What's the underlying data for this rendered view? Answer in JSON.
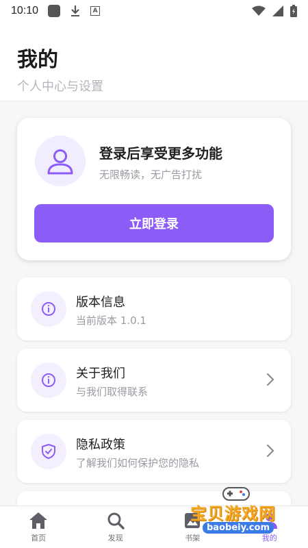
{
  "status_bar": {
    "time": "10:10",
    "a_badge": "A"
  },
  "header": {
    "title": "我的",
    "subtitle": "个人中心与设置"
  },
  "login_card": {
    "title": "登录后享受更多功能",
    "subtitle": "无限畅读，无广告打扰",
    "button_label": "立即登录"
  },
  "menu": [
    {
      "title": "版本信息",
      "desc": "当前版本 1.0.1",
      "icon": "info-icon",
      "has_chevron": false
    },
    {
      "title": "关于我们",
      "desc": "与我们取得联系",
      "icon": "info-icon",
      "has_chevron": true
    },
    {
      "title": "隐私政策",
      "desc": "了解我们如何保护您的隐私",
      "icon": "shield-check-icon",
      "has_chevron": true
    }
  ],
  "bottom_nav": [
    {
      "label": "首页",
      "icon": "home-icon"
    },
    {
      "label": "发现",
      "icon": "search-icon"
    },
    {
      "label": "书架",
      "icon": "bookshelf-icon"
    },
    {
      "label": "我的",
      "icon": "profile-icon",
      "active": true
    }
  ],
  "watermark": {
    "text": "宝贝游戏网",
    "url": "baobeiy.com"
  },
  "colors": {
    "accent": "#8b5cf6",
    "accent_light": "#f1ecfe",
    "muted": "#9a9aa3"
  }
}
